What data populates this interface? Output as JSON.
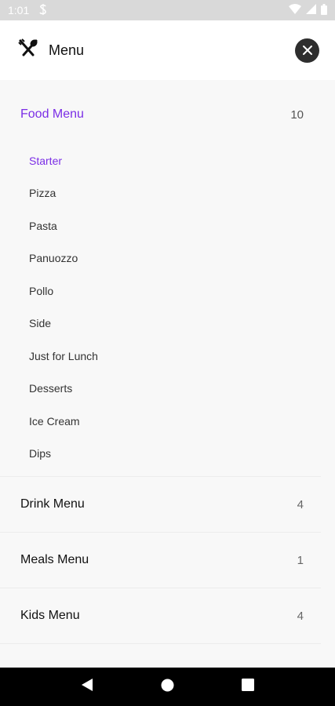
{
  "status_bar": {
    "time": "1:01",
    "app_icon": "notification-s-icon"
  },
  "header": {
    "title": "Menu",
    "icon": "fork-spoon-icon",
    "close_icon": "close-icon"
  },
  "categories": [
    {
      "label": "Food Menu",
      "count": "10",
      "expanded": true,
      "items": [
        "Starter",
        "Pizza",
        "Pasta",
        "Panuozzo",
        "Pollo",
        "Side",
        "Just for Lunch",
        "Desserts",
        "Ice Cream",
        "Dips"
      ],
      "active_item": "Starter"
    },
    {
      "label": "Drink Menu",
      "count": "4"
    },
    {
      "label": "Meals Menu",
      "count": "1"
    },
    {
      "label": "Kids Menu",
      "count": "4"
    }
  ],
  "colors": {
    "accent": "#7b2ee6",
    "header_bg": "#ffffff",
    "content_bg": "#f8f8f8",
    "nav_bg": "#000000"
  }
}
